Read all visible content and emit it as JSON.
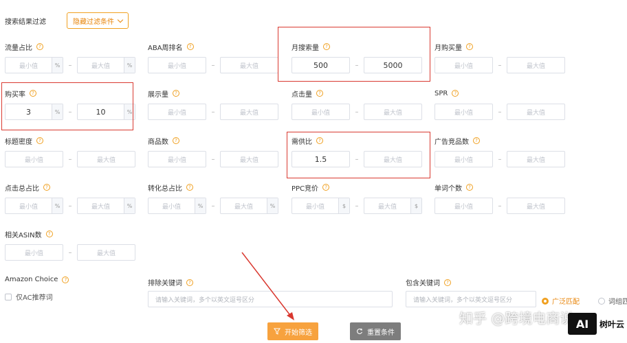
{
  "header": {
    "title": "搜索结果过滤",
    "toggle_label": "隐藏过滤条件"
  },
  "help_glyph": "?",
  "rows": [
    [
      {
        "label": "流量占比",
        "min": "最小值",
        "max": "最大值",
        "unit": "%"
      },
      {
        "label": "ABA周排名",
        "min": "最小值",
        "max": "最大值",
        "unit": ""
      },
      {
        "label": "月搜索量",
        "min": "500",
        "max": "5000",
        "unit": "",
        "filled": true
      },
      {
        "label": "月购买量",
        "min": "最小值",
        "max": "最大值",
        "unit": ""
      }
    ],
    [
      {
        "label": "购买率",
        "min": "3",
        "max": "10",
        "unit": "%",
        "filled": true
      },
      {
        "label": "展示量",
        "min": "最小值",
        "max": "最大值",
        "unit": ""
      },
      {
        "label": "点击量",
        "min": "最小值",
        "max": "最大值",
        "unit": ""
      },
      {
        "label": "SPR",
        "min": "最小值",
        "max": "最大值",
        "unit": ""
      }
    ],
    [
      {
        "label": "标题密度",
        "min": "最小值",
        "max": "最大值",
        "unit": ""
      },
      {
        "label": "商品数",
        "min": "最小值",
        "max": "最大值",
        "unit": ""
      },
      {
        "label": "需供比",
        "min": "1.5",
        "max": "最大值",
        "unit": "",
        "filled_min": true
      },
      {
        "label": "广告竞品数",
        "min": "最小值",
        "max": "最大值",
        "unit": ""
      }
    ],
    [
      {
        "label": "点击总占比",
        "min": "最小值",
        "max": "最大值",
        "unit": "%"
      },
      {
        "label": "转化总占比",
        "min": "最小值",
        "max": "最大值",
        "unit": "%"
      },
      {
        "label": "PPC竞价",
        "min": "最小值",
        "max": "最大值",
        "unit": "$"
      },
      {
        "label": "单词个数",
        "min": "最小值",
        "max": "最大值",
        "unit": ""
      }
    ],
    [
      {
        "label": "相关ASIN数",
        "min": "最小值",
        "max": "最大值",
        "unit": ""
      }
    ]
  ],
  "range_separator": "–",
  "amazon_choice": {
    "label": "Amazon Choice",
    "checkbox_label": "仅AC推荐词"
  },
  "exclude_keywords": {
    "label": "排除关键词",
    "placeholder": "请输入关键词，多个以英文逗号区分"
  },
  "include_keywords": {
    "label": "包含关键词",
    "placeholder": "请输入关键词，多个以英文逗号区分"
  },
  "match_options": [
    "广泛匹配",
    "词组匹配"
  ],
  "buttons": {
    "start": "开始筛选",
    "reset": "重置条件"
  },
  "watermark": {
    "zhihu": "知乎 @跨境电商说",
    "logo": "AI",
    "brand": "树叶云"
  },
  "colors": {
    "accent": "#f0a020",
    "highlight": "#d9382f",
    "reset": "#7d7d7d"
  }
}
